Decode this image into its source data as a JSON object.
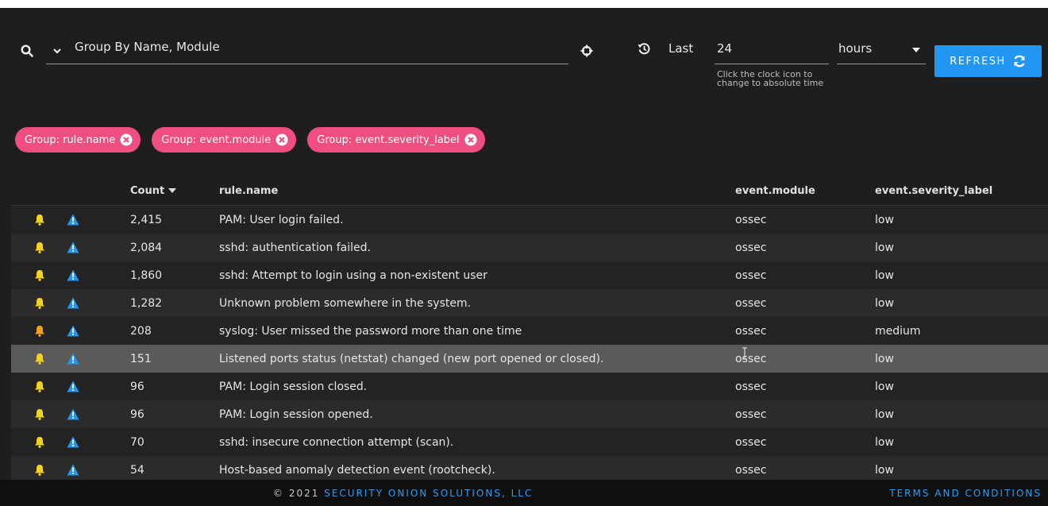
{
  "query": {
    "text": "Group By Name, Module"
  },
  "time": {
    "last_label": "Last",
    "value": "24",
    "unit": "hours",
    "hint": "Click the clock icon to change to absolute time"
  },
  "refresh_label": "REFRESH",
  "chips": [
    "Group: rule.name",
    "Group: event.module",
    "Group: event.severity_label"
  ],
  "table": {
    "headers": {
      "count": "Count",
      "rule": "rule.name",
      "module": "event.module",
      "severity": "event.severity_label"
    },
    "rows": [
      {
        "count": "2,415",
        "rule": "PAM: User login failed.",
        "module": "ossec",
        "severity": "low",
        "bell": "#f5d31a"
      },
      {
        "count": "2,084",
        "rule": "sshd: authentication failed.",
        "module": "ossec",
        "severity": "low",
        "bell": "#f5d31a"
      },
      {
        "count": "1,860",
        "rule": "sshd: Attempt to login using a non-existent user",
        "module": "ossec",
        "severity": "low",
        "bell": "#f5d31a"
      },
      {
        "count": "1,282",
        "rule": "Unknown problem somewhere in the system.",
        "module": "ossec",
        "severity": "low",
        "bell": "#f5d31a"
      },
      {
        "count": "208",
        "rule": "syslog: User missed the password more than one time",
        "module": "ossec",
        "severity": "medium",
        "bell": "#f5a21a"
      },
      {
        "count": "151",
        "rule": "Listened ports status (netstat) changed (new port opened or closed).",
        "module": "ossec",
        "severity": "low",
        "bell": "#f5d31a"
      },
      {
        "count": "96",
        "rule": "PAM: Login session closed.",
        "module": "ossec",
        "severity": "low",
        "bell": "#f5d31a"
      },
      {
        "count": "96",
        "rule": "PAM: Login session opened.",
        "module": "ossec",
        "severity": "low",
        "bell": "#f5d31a"
      },
      {
        "count": "70",
        "rule": "sshd: insecure connection attempt (scan).",
        "module": "ossec",
        "severity": "low",
        "bell": "#f5d31a"
      },
      {
        "count": "54",
        "rule": "Host-based anomaly detection event (rootcheck).",
        "module": "ossec",
        "severity": "low",
        "bell": "#f5d31a"
      }
    ]
  },
  "footer": {
    "copyright_prefix": "© 2021",
    "brand": "SECURITY ONION SOLUTIONS, LLC",
    "terms": "TERMS AND CONDITIONS"
  },
  "colors": {
    "accent": "#2196f3",
    "chip": "#ee4f80",
    "alert": "#2196f3"
  }
}
